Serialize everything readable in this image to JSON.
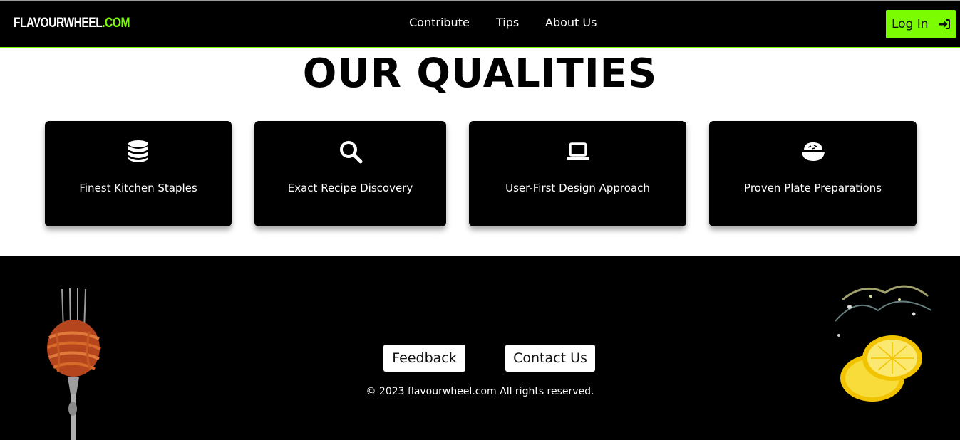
{
  "navbar": {
    "logo_main": "FLAVOURWHEEL",
    "logo_tld": ".COM",
    "links": [
      "Contribute",
      "Tips",
      "About Us"
    ],
    "login_label": "Log In",
    "login_icon": "sign-in-icon"
  },
  "main": {
    "heading": "OUR QUALITIES",
    "cards": [
      {
        "icon": "database-icon",
        "label": "Finest Kitchen Staples"
      },
      {
        "icon": "search-icon",
        "label": "Exact Recipe Discovery"
      },
      {
        "icon": "laptop-icon",
        "label": "User-First Design Approach"
      },
      {
        "icon": "bowl-rice-icon",
        "label": "Proven Plate Preparations"
      }
    ]
  },
  "footer": {
    "feedback_label": "Feedback",
    "contact_label": "Contact Us",
    "copyright": "© 2023 flavourwheel.com All rights reserved."
  },
  "colors": {
    "accent": "#7cfc00",
    "navbar_bg": "#000000",
    "card_bg": "#000000",
    "footer_bg": "#000000",
    "page_bg": "#ffffff"
  }
}
